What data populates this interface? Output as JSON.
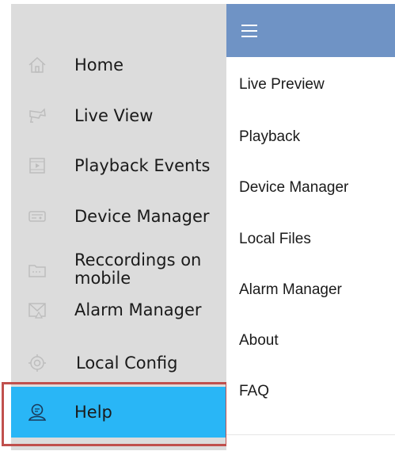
{
  "drawer": {
    "items": [
      {
        "label": "Home",
        "icon": "home-icon"
      },
      {
        "label": "Live View",
        "icon": "camera-icon"
      },
      {
        "label": "Playback Events",
        "icon": "playback-icon"
      },
      {
        "label": "Device Manager",
        "icon": "device-icon"
      },
      {
        "label": "Reccordings on\nmobile",
        "icon": "folder-icon"
      },
      {
        "label": "Alarm Manager",
        "icon": "alarm-icon"
      },
      {
        "label": "Local Config",
        "icon": "settings-icon"
      },
      {
        "label": "Help",
        "icon": "help-icon",
        "active": true
      }
    ]
  },
  "panel": {
    "header": {
      "menu_icon": "hamburger-icon",
      "color": "#6f93c5"
    },
    "items": [
      {
        "label": "Live Preview"
      },
      {
        "label": "Playback"
      },
      {
        "label": "Device Manager"
      },
      {
        "label": "Local Files"
      },
      {
        "label": "Alarm Manager"
      },
      {
        "label": "About"
      },
      {
        "label": "FAQ"
      }
    ]
  },
  "colors": {
    "drawer_bg": "#dcdcdc",
    "active_bg": "#29b6f6",
    "highlight_border": "#c0504d"
  }
}
